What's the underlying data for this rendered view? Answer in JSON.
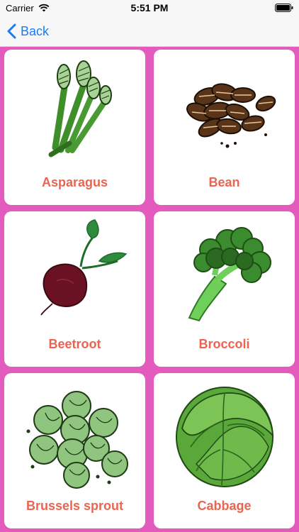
{
  "status_bar": {
    "carrier": "Carrier",
    "time": "5:51 PM",
    "icons": [
      "wifi-icon",
      "battery-icon"
    ]
  },
  "nav": {
    "back_label": "Back",
    "back_icon": "chevron-left-icon",
    "accent_color": "#1a7cf5"
  },
  "theme": {
    "background_color": "#e25bbd",
    "label_color": "#ec6450"
  },
  "vegetables": [
    {
      "label": "Asparagus",
      "icon": "asparagus-icon"
    },
    {
      "label": "Bean",
      "icon": "bean-icon"
    },
    {
      "label": "Beetroot",
      "icon": "beetroot-icon"
    },
    {
      "label": "Broccoli",
      "icon": "broccoli-icon"
    },
    {
      "label": "Brussels sprout",
      "icon": "brussels-sprout-icon"
    },
    {
      "label": "Cabbage",
      "icon": "cabbage-icon"
    }
  ]
}
